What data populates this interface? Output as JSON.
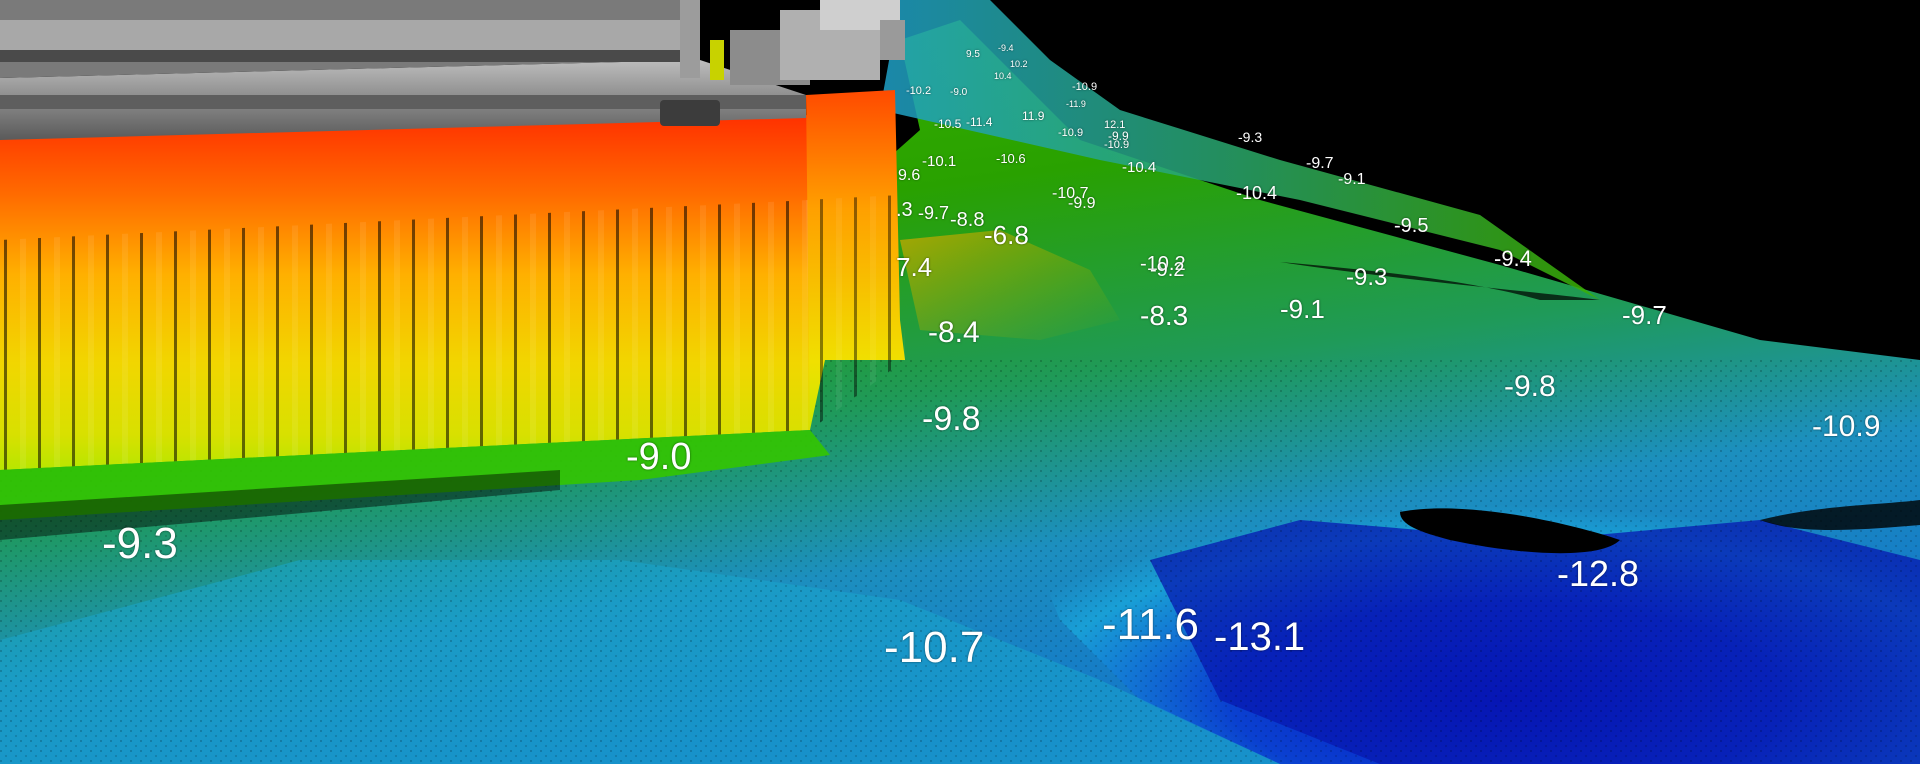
{
  "depth_labels": {
    "large": [
      "-9.3",
      "-9.0",
      "-10.7",
      "-11.6",
      "-13.1",
      "-9.8",
      "-8.4",
      "-12.8",
      "-9.8",
      "-10.9",
      "-9.7",
      "-8.3",
      "-9.1",
      "-9.3",
      "-9.4",
      "-9.5",
      "-6.8",
      "7.4"
    ],
    "medium": [
      "-10.2",
      "-9.2",
      "-10.4",
      "-9.7",
      "-9.1",
      "-10.4",
      "-9.3",
      "-8.8",
      ".3",
      "-9.7",
      "9.6",
      "-10.1",
      "-10.7",
      "-9.9"
    ],
    "small": [
      "-10.9",
      "-10.6",
      "-10.5",
      "-11.4",
      "11.9",
      "-10.9",
      "-9.9",
      "12.1",
      "-10.2",
      "-9.0",
      "9.5",
      "-9.4",
      "10.2",
      "10.4",
      "-11.9",
      "-10.9"
    ]
  },
  "colors": {
    "background": "#000000",
    "shallow": "#ff3a00",
    "mid_shallow": "#ffd400",
    "mid": "#2fb800",
    "mid_deep": "#2aa8d8",
    "deep": "#0414b8",
    "structure": "#8a8a8a",
    "label": "#ffffff"
  },
  "legend": "color encodes depth: red shallow, blue deep"
}
